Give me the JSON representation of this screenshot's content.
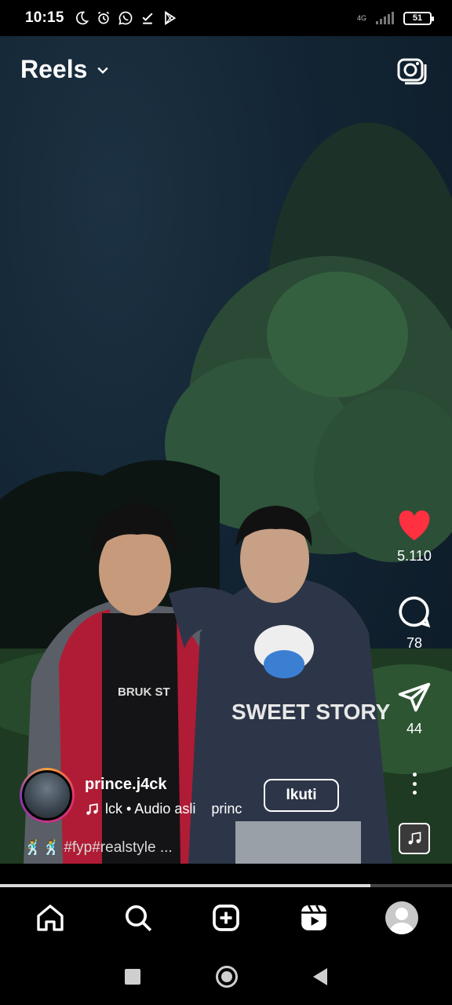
{
  "status_bar": {
    "time": "10:15",
    "network": "4G",
    "battery": "51",
    "icons": [
      "moon-icon",
      "alarm-icon",
      "whatsapp-icon",
      "download-done-icon",
      "play-store-icon"
    ]
  },
  "header": {
    "title": "Reels",
    "dropdown_icon": "chevron-down-icon",
    "camera_icon": "camera-icon"
  },
  "actions": {
    "likes": "5.110",
    "comments": "78",
    "shares": "44",
    "like_color": "#ff3040"
  },
  "owner": {
    "username": "prince.j4ck",
    "follow_label": "Ikuti",
    "audio_text": "lck • Audio asli",
    "audio_text_continued": "princ"
  },
  "caption": {
    "emoji": "🕺🕺",
    "text": "#fyp#realstyle ..."
  },
  "progress": {
    "fraction": 0.82
  },
  "bottom_nav": {
    "items": [
      "home-icon",
      "search-icon",
      "create-icon",
      "reels-icon",
      "profile-avatar"
    ]
  }
}
